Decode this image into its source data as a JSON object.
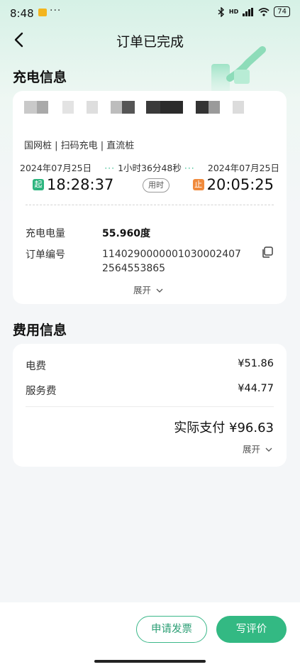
{
  "status_bar": {
    "time": "8:48",
    "more": "···",
    "signal": "HD",
    "battery": "74"
  },
  "nav": {
    "title": "订单已完成"
  },
  "charge_info": {
    "section_title": "充电信息",
    "station_tags": "国网桩 | 扫码充电 | 直流桩",
    "start_date": "2024年07月25日",
    "end_date": "2024年07月25日",
    "duration": "1小时36分48秒",
    "start_badge": "起",
    "end_badge": "止",
    "start_time": "18:28:37",
    "end_time": "20:05:25",
    "used_label": "用时",
    "energy_label": "充电电量",
    "energy_value": "55.960度",
    "order_label": "订单编号",
    "order_number": "11402900000010300024072564553865",
    "expand_label": "展开"
  },
  "fee_info": {
    "section_title": "费用信息",
    "electricity_label": "电费",
    "electricity_value": "¥51.86",
    "service_label": "服务费",
    "service_value": "¥44.77",
    "total_text": "实际支付 ¥96.63",
    "expand_label": "展开"
  },
  "actions": {
    "invoice_label": "申请发票",
    "review_label": "写评价"
  },
  "colors": {
    "brand_green": "#33b983",
    "start_badge": "#2db57f",
    "end_badge": "#f08a3c"
  }
}
